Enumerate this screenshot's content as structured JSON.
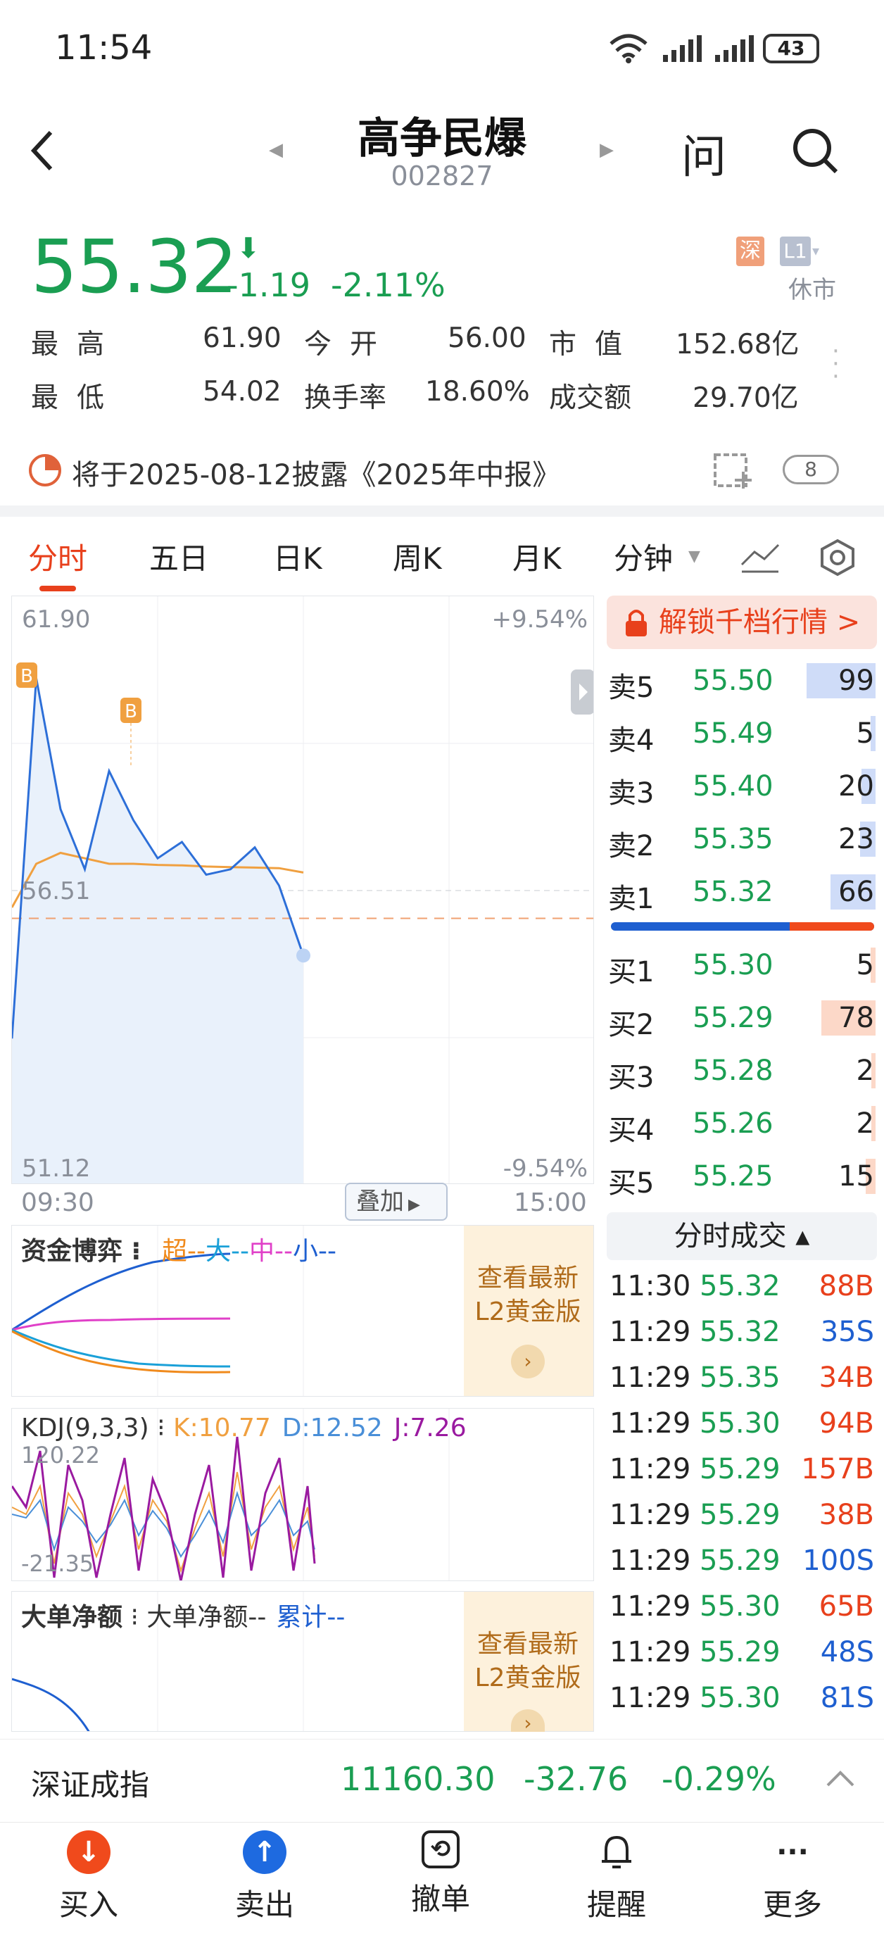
{
  "status": {
    "time": "11:54",
    "battery": "43",
    "network": "6"
  },
  "header": {
    "title": "高争民爆",
    "code": "002827",
    "ask": "问"
  },
  "quote": {
    "price": "55.32",
    "change": "-1.19",
    "change_pct": "-2.11%",
    "exchange_badge": "深",
    "level_badge": "L1",
    "market_status": "休市"
  },
  "stats": {
    "high_label": "最高",
    "high": "61.90",
    "open_label": "今开",
    "open": "56.00",
    "cap_label": "市值",
    "cap": "152.68亿",
    "low_label": "最低",
    "low": "54.02",
    "turnover_label": "换手率",
    "turnover": "18.60%",
    "amount_label": "成交额",
    "amount": "29.70亿"
  },
  "notice": {
    "text": "将于2025-08-12披露《2025年中报》",
    "count": "8"
  },
  "tabs": [
    "分时",
    "五日",
    "日K",
    "周K",
    "月K",
    "分钟"
  ],
  "chart": {
    "ymax": "61.90",
    "ymid": "56.51",
    "ymin": "51.12",
    "pct_max": "+9.54%",
    "pct_min": "-9.54%",
    "t_start": "09:30",
    "t_end": "15:00",
    "overlay_btn": "叠加",
    "marker": "B"
  },
  "chart_data": {
    "type": "line",
    "title": "",
    "xlabel": "",
    "ylabel": "",
    "ylim": [
      51.12,
      61.9
    ],
    "x": [
      "09:30",
      "09:40",
      "09:50",
      "10:00",
      "10:10",
      "10:20",
      "10:30",
      "10:40",
      "10:50",
      "11:00",
      "11:10",
      "11:20",
      "11:30"
    ],
    "series": [
      {
        "name": "price",
        "values": [
          53.8,
          60.4,
          58.0,
          56.9,
          58.7,
          57.8,
          57.1,
          57.4,
          56.8,
          56.9,
          57.3,
          56.6,
          55.32
        ]
      },
      {
        "name": "avg",
        "values": [
          56.2,
          57.0,
          57.2,
          57.1,
          57.0,
          57.0,
          56.98,
          56.97,
          56.95,
          56.94,
          56.93,
          56.92,
          56.84
        ]
      }
    ]
  },
  "panels": {
    "fund_title": "资金博弈",
    "fund_legend": [
      {
        "name": "超--",
        "color": "#f08a1c"
      },
      {
        "name": "大--",
        "color": "#1aa0d8"
      },
      {
        "name": "中--",
        "color": "#e040c8"
      },
      {
        "name": "小--",
        "color": "#1e5fd0"
      }
    ],
    "upgrade_text_1": "查看最新",
    "upgrade_text_2": "L2黄金版",
    "kdj_title": "KDJ(9,3,3)",
    "kdj_k": "K:10.77",
    "kdj_d": "D:12.52",
    "kdj_j": "J:7.26",
    "kdj_top": "120.22",
    "kdj_bot": "-21.35",
    "big_title": "大单净额",
    "big_legend_1": "大单净额--",
    "big_legend_2": "累计--"
  },
  "orderbook": {
    "unlock": "解锁千档行情 >",
    "asks": [
      {
        "label": "卖5",
        "price": "55.50",
        "qty": "99",
        "bar": 0.7
      },
      {
        "label": "卖4",
        "price": "55.49",
        "qty": "5",
        "bar": 0.05
      },
      {
        "label": "卖3",
        "price": "55.40",
        "qty": "20",
        "bar": 0.14
      },
      {
        "label": "卖2",
        "price": "55.35",
        "qty": "23",
        "bar": 0.16
      },
      {
        "label": "卖1",
        "price": "55.32",
        "qty": "66",
        "bar": 0.46
      }
    ],
    "bids": [
      {
        "label": "买1",
        "price": "55.30",
        "qty": "5",
        "bar": 0.05
      },
      {
        "label": "买2",
        "price": "55.29",
        "qty": "78",
        "bar": 0.55
      },
      {
        "label": "买3",
        "price": "55.28",
        "qty": "2",
        "bar": 0.02
      },
      {
        "label": "买4",
        "price": "55.26",
        "qty": "2",
        "bar": 0.02
      },
      {
        "label": "买5",
        "price": "55.25",
        "qty": "15",
        "bar": 0.1
      }
    ],
    "trades_title": "分时成交 ▴",
    "trades": [
      {
        "t": "11:30",
        "p": "55.32",
        "v": "88B",
        "c": "r"
      },
      {
        "t": "11:29",
        "p": "55.32",
        "v": "35S",
        "c": "b"
      },
      {
        "t": "11:29",
        "p": "55.35",
        "v": "34B",
        "c": "r"
      },
      {
        "t": "11:29",
        "p": "55.30",
        "v": "94B",
        "c": "r"
      },
      {
        "t": "11:29",
        "p": "55.29",
        "v": "157B",
        "c": "r"
      },
      {
        "t": "11:29",
        "p": "55.29",
        "v": "38B",
        "c": "r"
      },
      {
        "t": "11:29",
        "p": "55.29",
        "v": "100S",
        "c": "b"
      },
      {
        "t": "11:29",
        "p": "55.30",
        "v": "65B",
        "c": "r"
      },
      {
        "t": "11:29",
        "p": "55.29",
        "v": "48S",
        "c": "b"
      },
      {
        "t": "11:29",
        "p": "55.30",
        "v": "81S",
        "c": "b"
      }
    ]
  },
  "index_bar": {
    "name": "深证成指",
    "value": "11160.30",
    "change": "-32.76",
    "pct": "-0.29%"
  },
  "bottom": [
    {
      "label": "买入",
      "color": "#f04a1c",
      "glyph": "↓"
    },
    {
      "label": "卖出",
      "color": "#1e6ae0",
      "glyph": "↑"
    },
    {
      "label": "撤单",
      "glyph": "⟲"
    },
    {
      "label": "提醒",
      "glyph": "🔔"
    },
    {
      "label": "更多",
      "glyph": "···"
    }
  ]
}
